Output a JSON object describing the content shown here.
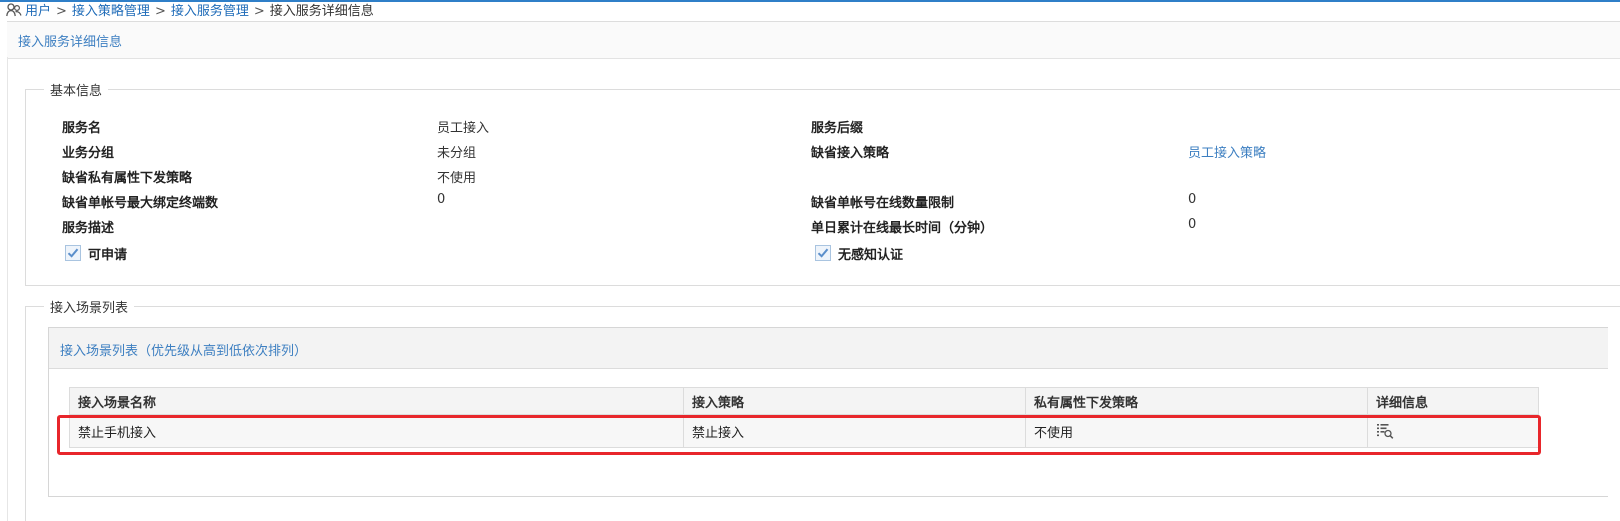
{
  "breadcrumb": {
    "items": [
      "用户",
      "接入策略管理",
      "接入服务管理"
    ],
    "separator": ">",
    "current": "接入服务详细信息"
  },
  "page_title": "接入服务详细信息",
  "basic_info": {
    "legend": "基本信息",
    "service_name_label": "服务名",
    "service_name_value": "员工接入",
    "service_suffix_label": "服务后缀",
    "service_suffix_value": "",
    "business_group_label": "业务分组",
    "business_group_value": "未分组",
    "default_policy_label": "缺省接入策略",
    "default_policy_value": "员工接入策略",
    "private_attr_label": "缺省私有属性下发策略",
    "private_attr_value": "不使用",
    "max_bind_label": "缺省单帐号最大绑定终端数",
    "max_bind_value": "0",
    "online_limit_label": "缺省单帐号在线数量限制",
    "online_limit_value": "0",
    "desc_label": "服务描述",
    "desc_value": "",
    "daily_online_label": "单日累计在线最长时间（分钟）",
    "daily_online_value": "0",
    "applicable_label": "可申请",
    "applicable_checked": true,
    "seamless_label": "无感知认证",
    "seamless_checked": true
  },
  "scene_section": {
    "legend": "接入场景列表",
    "panel_title": "接入场景列表（优先级从高到低依次排列）",
    "columns": [
      "接入场景名称",
      "接入策略",
      "私有属性下发策略",
      "详细信息"
    ],
    "rows": [
      {
        "name": "禁止手机接入",
        "policy": "禁止接入",
        "private_policy": "不使用",
        "detail_icon": "detail-view-icon"
      }
    ]
  },
  "colors": {
    "link": "#3d7fc1",
    "breadcrumb_link": "#1e6bb8",
    "highlight": "#e8262b",
    "top_line": "#2f7fc8"
  }
}
